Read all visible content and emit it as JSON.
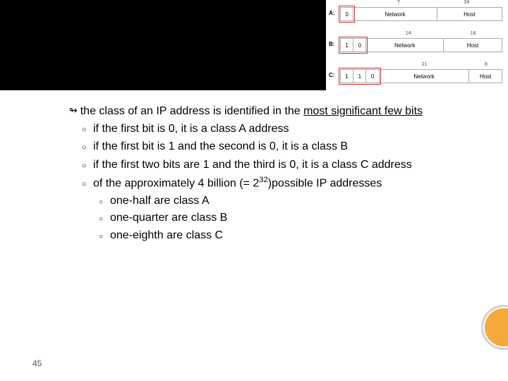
{
  "diagram": {
    "rowA": {
      "label": "A:",
      "ticks": [
        "7",
        "24"
      ],
      "bits": [
        "0"
      ],
      "netLabel": "Network",
      "hostLabel": "Host"
    },
    "rowB": {
      "label": "B:",
      "ticks": [
        "14",
        "16"
      ],
      "bits": [
        "1",
        "0"
      ],
      "netLabel": "Network",
      "hostLabel": "Host"
    },
    "rowC": {
      "label": "C:",
      "ticks": [
        "21",
        "8"
      ],
      "bits": [
        "1",
        "1",
        "0"
      ],
      "netLabel": "Network",
      "hostLabel": "Host"
    }
  },
  "text": {
    "lead_pre": "the class of an IP address is identified in the ",
    "lead_u": "most significant few bits",
    "c1": "if the first bit is 0, it is a class A address",
    "c2": "if the first bit is 1 and the second is 0, it is a class B",
    "c3": "if the first two bits are 1 and the third is 0, it is a class C address",
    "c4_pre": "of the approximately 4 billion (= 2",
    "c4_exp": "32",
    "c4_post": ")possible IP addresses",
    "s1": "one-half are class A",
    "s2": "one-quarter are class B",
    "s3": "one-eighth are class C"
  },
  "page": "45"
}
